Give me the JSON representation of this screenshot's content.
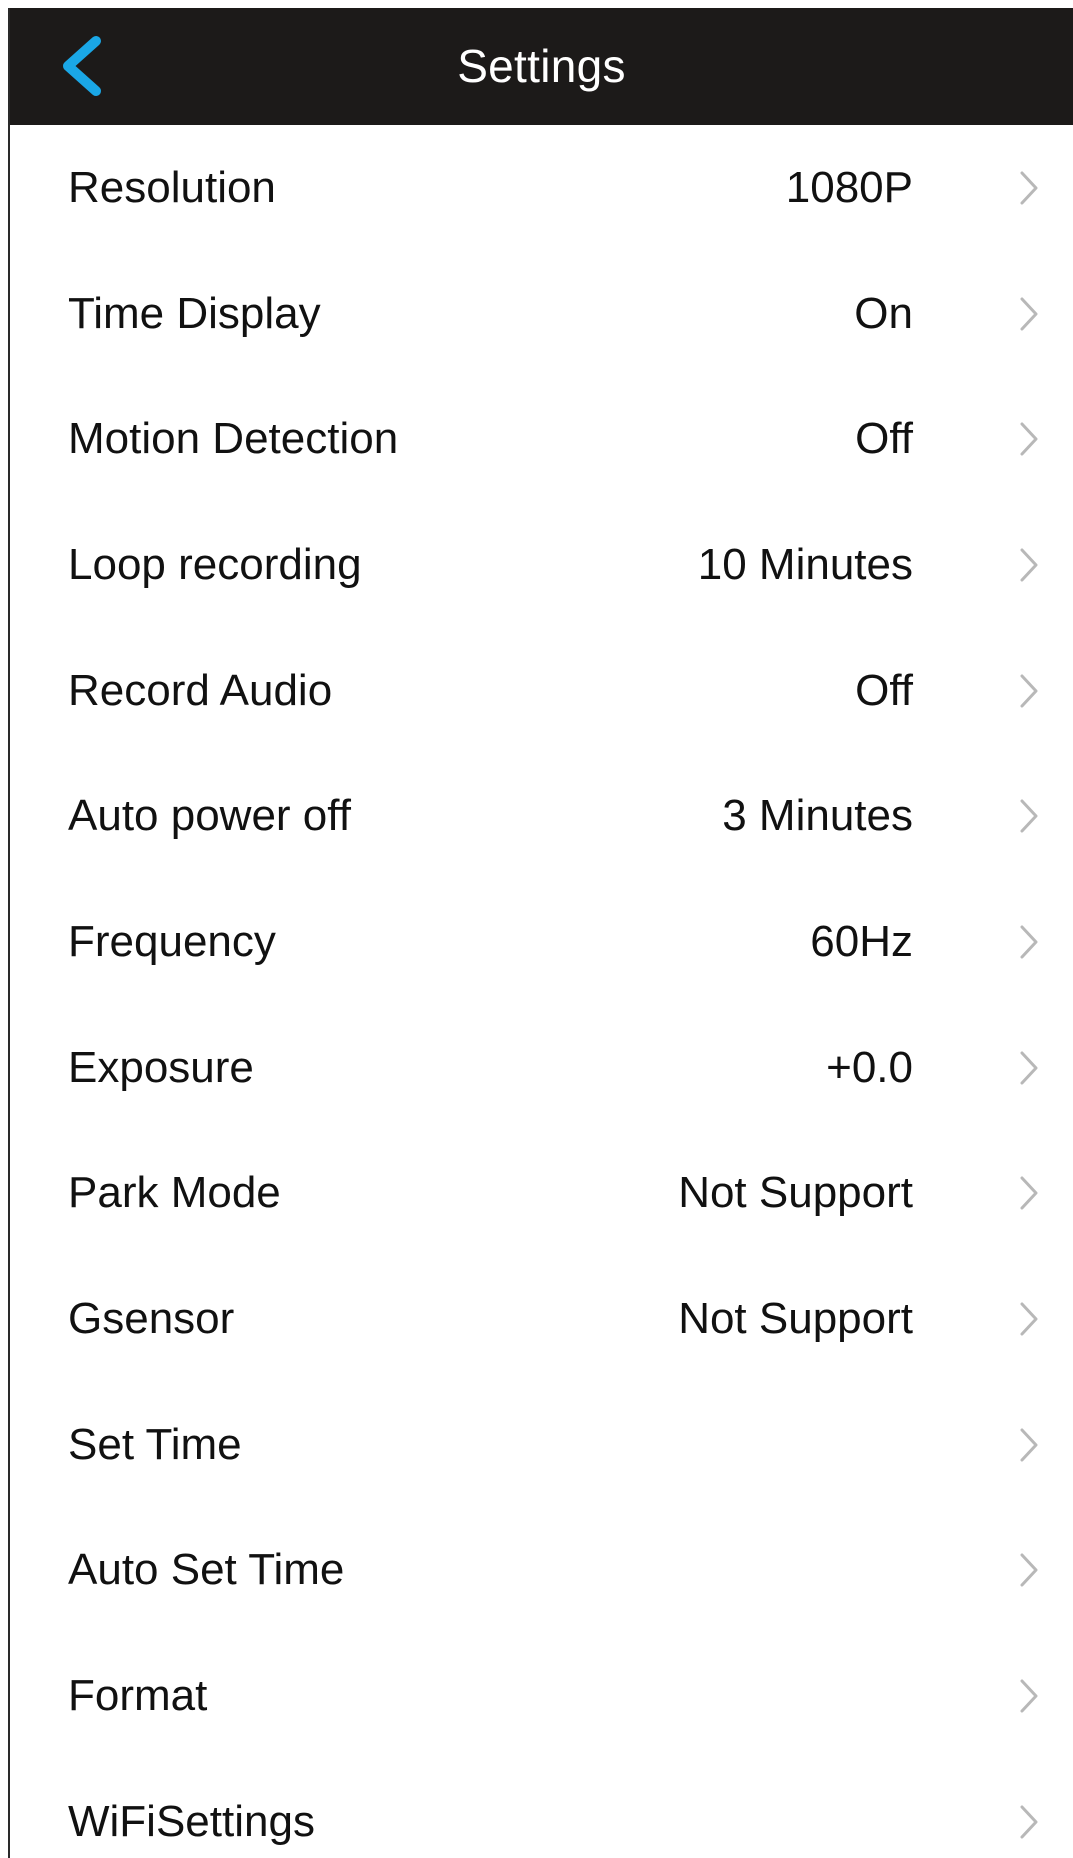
{
  "header": {
    "title": "Settings",
    "back_icon": "chevron-left-icon",
    "accent_color": "#1aa7e6",
    "background_color": "#1c1a19"
  },
  "settings": [
    {
      "label": "Resolution",
      "value": "1080P"
    },
    {
      "label": "Time Display",
      "value": "On"
    },
    {
      "label": "Motion Detection",
      "value": "Off"
    },
    {
      "label": "Loop recording",
      "value": "10 Minutes"
    },
    {
      "label": "Record Audio",
      "value": "Off"
    },
    {
      "label": "Auto power off",
      "value": "3 Minutes"
    },
    {
      "label": "Frequency",
      "value": "60Hz"
    },
    {
      "label": "Exposure",
      "value": "+0.0"
    },
    {
      "label": "Park Mode",
      "value": "Not Support"
    },
    {
      "label": "Gsensor",
      "value": "Not Support"
    },
    {
      "label": "Set Time",
      "value": ""
    },
    {
      "label": "Auto Set Time",
      "value": ""
    },
    {
      "label": "Format",
      "value": ""
    },
    {
      "label": "WiFiSettings",
      "value": ""
    }
  ],
  "row_chevron_icon": "chevron-right-icon"
}
